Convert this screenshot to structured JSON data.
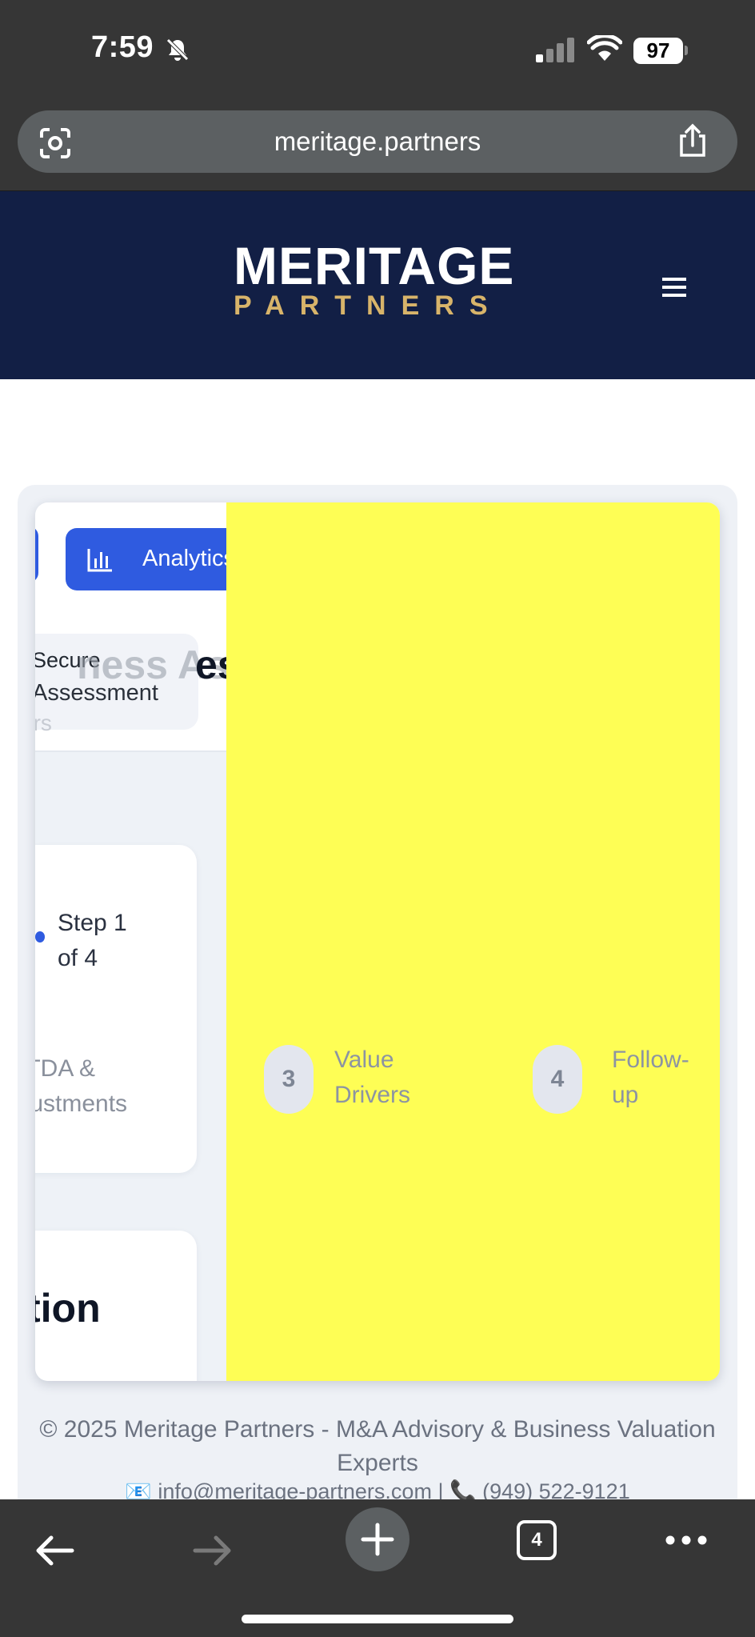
{
  "status_bar": {
    "time": "7:59",
    "battery": "97",
    "icons": [
      "bell-off-icon",
      "signal-icon",
      "wifi-icon"
    ]
  },
  "browser": {
    "url": "meritage.partners",
    "tab_count": "4",
    "icons": [
      "lens-icon",
      "share-icon",
      "back-icon",
      "forward-icon",
      "plus-icon",
      "more-icon"
    ]
  },
  "site_header": {
    "logo_main": "MERITAGE",
    "logo_sub": "PARTNERS",
    "menu_icon": "hamburger-icon",
    "colors": {
      "header_bg": "#121f45",
      "logo_gold": "#d8b46a"
    }
  },
  "panel": {
    "analytics_button": "Analytics",
    "secure_line1": "Secure",
    "secure_line2": "Assessment",
    "ghost_text": "ers",
    "title_ghost": "ness Ass",
    "title": "essment",
    "step_progress": "Step 1 of 4",
    "step2_name": "ITDA & ljustments",
    "section_title": "tion",
    "steps": [
      {
        "number": "3",
        "label": "Value Drivers"
      },
      {
        "number": "4",
        "label": "Follow-up"
      }
    ],
    "colors": {
      "accent": "#2f5be0",
      "overlay": "#fefe55"
    }
  },
  "footer": {
    "copyright": "© 2025 Meritage Partners - M&A Advisory & Business Valuation Experts",
    "contact": "📧 info@meritage-partners.com | 📞 (949) 522-9121"
  }
}
